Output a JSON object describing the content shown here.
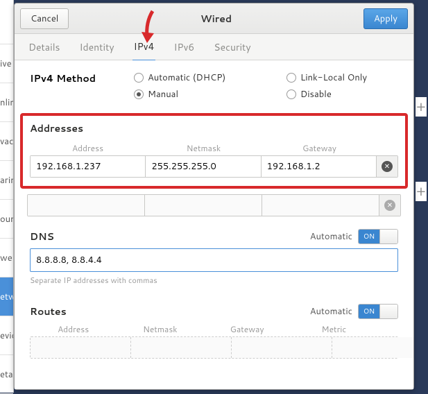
{
  "header": {
    "cancel": "Cancel",
    "title": "Wired",
    "apply": "Apply"
  },
  "tabs": [
    "Details",
    "Identity",
    "IPv4",
    "IPv6",
    "Security"
  ],
  "active_tab": 2,
  "method": {
    "label": "IPv4 Method",
    "options": [
      "Automatic (DHCP)",
      "Link-Local Only",
      "Manual",
      "Disable"
    ],
    "selected": 2
  },
  "addresses": {
    "title": "Addresses",
    "cols": [
      "Address",
      "Netmask",
      "Gateway"
    ],
    "rows": [
      {
        "address": "192.168.1.237",
        "netmask": "255.255.255.0",
        "gateway": "192.168.1.2"
      },
      {
        "address": "",
        "netmask": "",
        "gateway": ""
      }
    ]
  },
  "dns": {
    "title": "DNS",
    "automatic_label": "Automatic",
    "toggle_on": "ON",
    "value": "8.8.8.8, 8.8.4.4",
    "hint": "Separate IP addresses with commas"
  },
  "routes": {
    "title": "Routes",
    "automatic_label": "Automatic",
    "toggle_on": "ON",
    "cols": [
      "Address",
      "Netmask",
      "Gateway",
      "Metric"
    ]
  },
  "sidebar_fragments": [
    "ive",
    "nlin",
    "vac",
    "arin",
    "oun",
    "we",
    "etw",
    "evic",
    "etail"
  ]
}
